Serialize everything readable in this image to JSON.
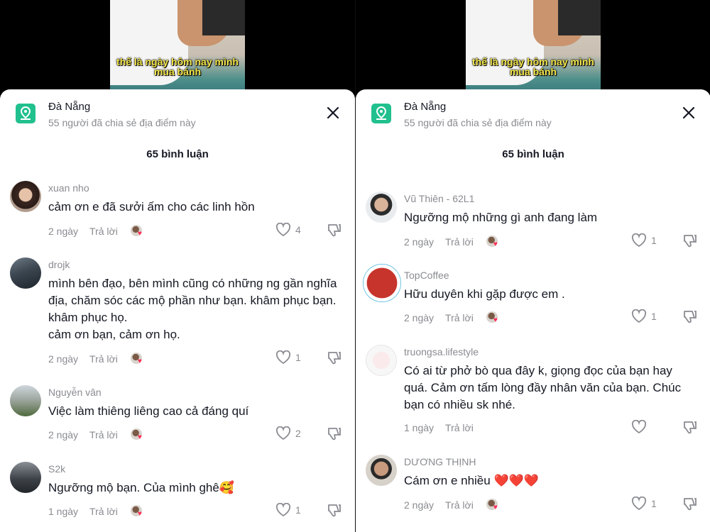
{
  "panels": [
    {
      "video_caption": "thế là ngày hôm nay mình mua bánh",
      "location": {
        "title": "Đà Nẵng",
        "subtitle": "55 người đã chia sẻ địa điểm này"
      },
      "comment_count": "65 bình luận",
      "comments": [
        {
          "user": "xuan nho",
          "text": "cảm ơn e đã sưởi ấm cho các linh hồn",
          "time": "2 ngày",
          "reply": "Trả lời",
          "likes": "4"
        },
        {
          "user": "drojk",
          "text": "mình bên đạo, bên mình cũng có những ng gần nghĩa địa, chăm sóc các mộ phần như bạn. khâm phục bạn. khâm phục họ.\ncảm ơn bạn, cảm ơn họ.",
          "time": "2 ngày",
          "reply": "Trả lời",
          "likes": "1"
        },
        {
          "user": "Nguyễn vân",
          "text": "Việc làm thiêng liêng cao cả đáng quí",
          "time": "2 ngày",
          "reply": "Trả lời",
          "likes": "2"
        },
        {
          "user": "S2k",
          "text": "Ngưỡng mộ bạn. Của mình ghê🥰",
          "time": "1 ngày",
          "reply": "Trả lời",
          "likes": "1"
        }
      ]
    },
    {
      "video_caption": "thế là ngày hôm nay mình mua bánh",
      "location": {
        "title": "Đà Nẵng",
        "subtitle": "55 người đã chia sẻ địa điểm này"
      },
      "comment_count": "65 bình luận",
      "comments": [
        {
          "user": "Vũ Thiên - 62L1",
          "text": "Ngưỡng mộ những gì anh đang làm",
          "time": "2 ngày",
          "reply": "Trả lời",
          "likes": "1"
        },
        {
          "user": "TopCoffee",
          "text": "Hữu duyên khi gặp được em .",
          "time": "2 ngày",
          "reply": "Trả lời",
          "likes": "1"
        },
        {
          "user": "truongsa.lifestyle",
          "text": "Có ai từ phở bò qua đây k, giọng đọc của bạn hay quá. Cảm ơn tấm lòng đầy nhân văn của bạn. Chúc bạn có nhiều sk nhé.",
          "time": "1 ngày",
          "reply": "Trả lời",
          "likes": ""
        },
        {
          "user": "DƯƠNG THỊNH",
          "text": "Cám ơn e nhiều ❤️❤️❤️",
          "time": "2 ngày",
          "reply": "Trả lời",
          "likes": "1"
        }
      ]
    }
  ],
  "colors": {
    "accent": "#21c08e",
    "heart": "#fe2c55",
    "muted": "#8a8b91",
    "text": "#161823"
  },
  "icons": [
    "location-icon",
    "close-icon",
    "heart-outline-icon",
    "dislike-icon",
    "reaction-avatar-icon"
  ]
}
